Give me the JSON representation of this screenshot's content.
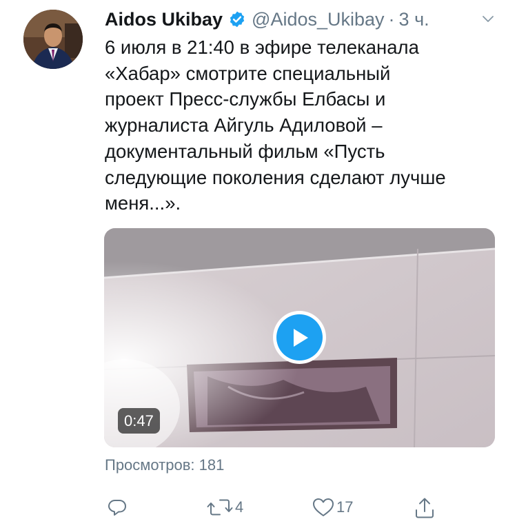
{
  "tweet": {
    "author_name": "Aidos Ukibay",
    "handle": "@Aidos_Ukibay",
    "separator": "·",
    "time": "3 ч.",
    "text_lines": [
      "6 июля в 21:40 в эфире телеканала",
      "«Хабар» смотрите специальный",
      "проект Пресс-службы Елбасы и",
      "журналиста Айгуль Адиловой –",
      "документальный фильм «Пусть",
      "следующие поколения сделают лучше",
      "меня...»."
    ],
    "video": {
      "duration": "0:47"
    },
    "views": "Просмотров: 181",
    "actions": {
      "reply_count": "",
      "retweet_count": "4",
      "like_count": "17"
    }
  },
  "icons": {
    "verified": "verified-badge-icon",
    "caret": "chevron-down-icon",
    "reply": "reply-icon",
    "retweet": "retweet-icon",
    "like": "heart-icon",
    "share": "share-icon",
    "play": "play-icon"
  },
  "colors": {
    "accent": "#1da1f2",
    "muted": "#657786",
    "text": "#14171a"
  }
}
